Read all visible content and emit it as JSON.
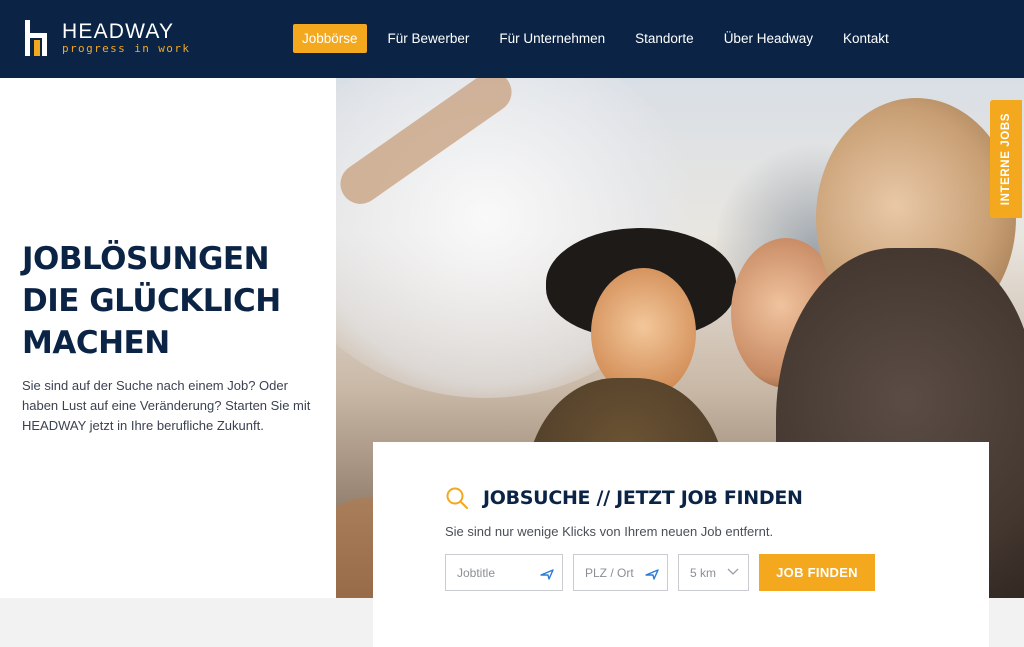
{
  "brand": {
    "name": "HEADWAY",
    "tagline": "progress in work",
    "colors": {
      "navy": "#0b2446",
      "accent": "#f4a81d"
    }
  },
  "nav": {
    "items": [
      {
        "label": "Jobbörse",
        "active": true
      },
      {
        "label": "Für Bewerber",
        "active": false
      },
      {
        "label": "Für Unternehmen",
        "active": false
      },
      {
        "label": "Standorte",
        "active": false
      },
      {
        "label": "Über Headway",
        "active": false
      },
      {
        "label": "Kontakt",
        "active": false
      }
    ]
  },
  "hero": {
    "title_lines": [
      "JOBLÖSUNGEN",
      "DIE GLÜCKLICH",
      "MACHEN"
    ],
    "text": "Sie sind auf der Suche nach einem Job? Oder haben Lust auf eine Veränderung? Starten Sie mit HEADWAY jetzt in Ihre berufliche Zukunft."
  },
  "side_tab": {
    "label": "INTERNE JOBS"
  },
  "search": {
    "icon": "search-icon",
    "title": "JOBSUCHE // JETZT JOB FINDEN",
    "subtitle": "Sie sind nur wenige Klicks von Ihrem neuen Job entfernt.",
    "job_placeholder": "Jobtitle",
    "location_placeholder": "PLZ / Ort",
    "radius_value": "5 km",
    "button_label": "JOB FINDEN"
  }
}
